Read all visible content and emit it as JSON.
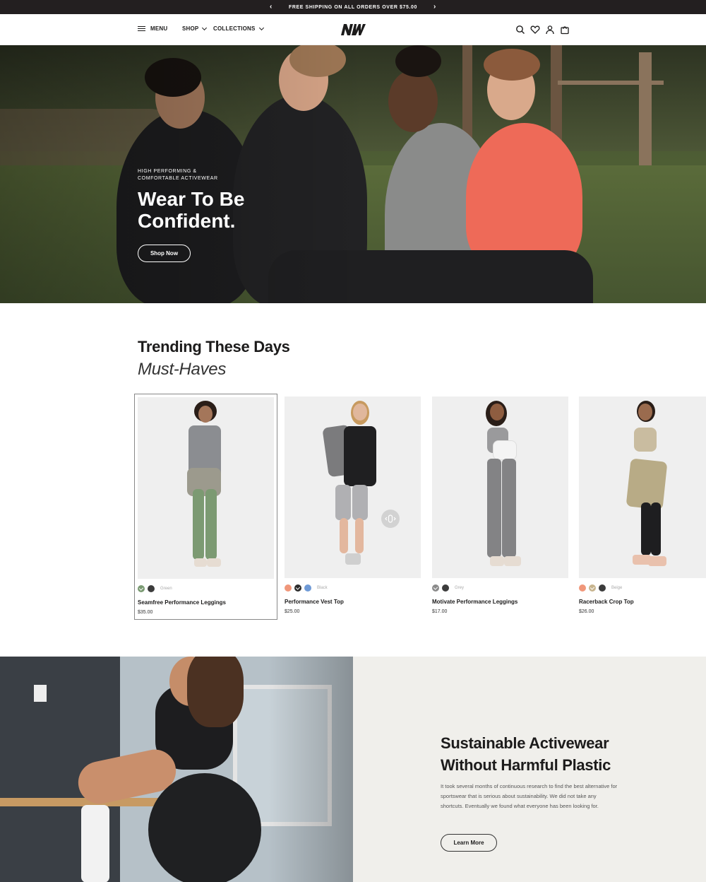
{
  "announcement": {
    "text": "FREE SHIPPING ON ALL ORDERS OVER $75.00",
    "prev_icon": "chevron-left-icon",
    "next_icon": "chevron-right-icon"
  },
  "header": {
    "menu_label": "MENU",
    "nav": [
      {
        "label": "SHOP"
      },
      {
        "label": "COLLECTIONS"
      }
    ],
    "logo_text": "NW",
    "icons": [
      "search-icon",
      "heart-icon",
      "user-icon",
      "cart-icon"
    ]
  },
  "hero": {
    "eyebrow": "HIGH PERFORMING & COMFORTABLE ACTIVEWEAR",
    "title": "Wear To Be Confident.",
    "button": "Shop Now"
  },
  "trending": {
    "title": "Trending These Days",
    "subtitle": "Must-Haves",
    "products": [
      {
        "name": "Seamfree Performance Leggings",
        "price": "$35.00",
        "selected_color": "Green",
        "swatches": [
          {
            "color": "#7a9a72",
            "selected": true
          },
          {
            "color": "#3c3c3c",
            "selected": false
          }
        ]
      },
      {
        "name": "Performance Vest Top",
        "price": "$25.00",
        "selected_color": "Black",
        "swatches": [
          {
            "color": "#f0977a",
            "selected": false
          },
          {
            "color": "#2b2b2b",
            "selected": true
          },
          {
            "color": "#6f9ad6",
            "selected": false
          }
        ]
      },
      {
        "name": "Motivate Performance Leggings",
        "price": "$17.00",
        "selected_color": "Grey",
        "swatches": [
          {
            "color": "#8a8a8a",
            "selected": true
          },
          {
            "color": "#3c3c3c",
            "selected": false
          }
        ]
      },
      {
        "name": "Racerback Crop Top",
        "price": "$26.00",
        "selected_color": "Beige",
        "swatches": [
          {
            "color": "#f0977a",
            "selected": false
          },
          {
            "color": "#c7b48e",
            "selected": true
          },
          {
            "color": "#3c3c3c",
            "selected": false
          }
        ]
      }
    ]
  },
  "sustainable": {
    "title": "Sustainable Activewear Without Harmful Plastic",
    "body": "It took several months of continuous research to find the best alternative for sportswear that is serious about sustainability.  We did not take any shortcuts. Eventually we found what everyone has been looking for.",
    "button": "Learn More"
  }
}
